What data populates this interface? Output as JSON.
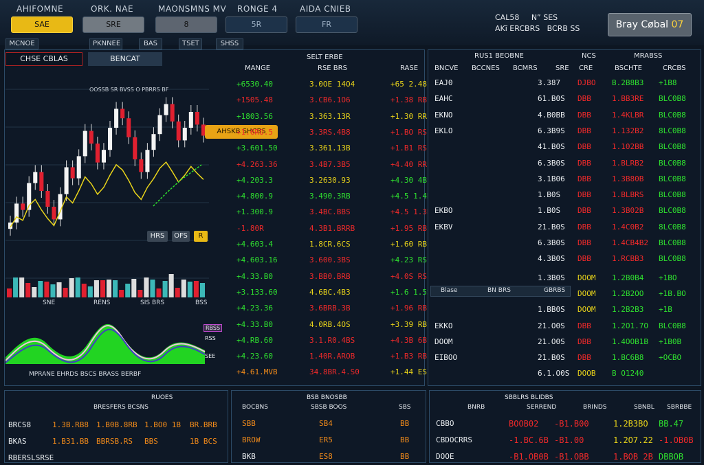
{
  "menu": {
    "items": [
      "AHIFOMNE",
      "ORK. NAE",
      "MAONSMNS MV",
      "RONGE 4",
      "AIDA CNIEB"
    ]
  },
  "toolbar": {
    "buttons": [
      "SAE",
      "SRE",
      "8",
      "5R",
      "FR"
    ]
  },
  "clock": {
    "line1": "CAL58     N” SES",
    "line2": "AKĩ ERCBRS   BCRB SS"
  },
  "buy_button": {
    "label": "Bray Cøbal",
    "suffix": "07"
  },
  "tabs": [
    "MCNOE",
    "PKNNEE",
    "BAS",
    "TSET",
    "SHSS"
  ],
  "left_tabs": {
    "active": "CHSE CBLAS",
    "second": "BENCAT"
  },
  "chart": {
    "title": "OOSSB SR BVSS O PBRRS BF",
    "badge": "AHSKB SHCBS",
    "mini_labels": [
      "HRS",
      "OFS",
      "R"
    ],
    "axis_labels": [
      "SNE",
      "RENS",
      "SIS BRS",
      "BSS"
    ],
    "osc_labels": [
      "RBSS",
      "RSS",
      "SEE"
    ],
    "osc_axis": "MPRANE EHRDS BSCS BRASS BERBF"
  },
  "chart_data": {
    "type": "line",
    "title": "OOSSB SR BVSS O PBRRS BF",
    "xlabel": "",
    "ylabel": "",
    "series": [
      {
        "values": [
          20,
          32,
          28,
          45,
          52,
          40,
          30,
          22,
          38,
          55,
          48,
          62,
          78,
          70,
          58,
          66,
          80,
          92,
          86,
          74,
          60,
          52,
          66,
          76,
          88,
          95,
          84,
          72,
          80,
          90,
          82,
          75
        ]
      }
    ]
  },
  "quotes_headers": [
    "MANGE",
    "RSE BRS",
    "RASE"
  ],
  "quotes_title": "SELT ERBE",
  "quotes": [
    [
      "+6530.40",
      "3.0OE 14O4",
      "+65 2.48"
    ],
    [
      "+1505.48",
      "3.CB6.1O6",
      "+1.38 RB"
    ],
    [
      "+1803.56",
      "3.363.13R",
      "+1.30 RR"
    ],
    [
      "+1.6RO.5",
      "3.3RS.4B8",
      "+1.BO RS"
    ],
    [
      "+3.601.50",
      "3.361.13B",
      "+1.B1 RS"
    ],
    [
      "+4.263.36",
      "3.4B7.3B5",
      "+4.40 RR"
    ],
    [
      "+4.203.3",
      "3.2630.93",
      "+4.30 4B"
    ],
    [
      "+4.800.9",
      "3.490.3RB",
      "+4.5 1.4B"
    ],
    [
      "+1.300.9",
      "3.4BC.BBS",
      "+4.5 1.3B"
    ],
    [
      "-1.80R",
      "4.3B1.BRRB",
      "+1.95 RB"
    ],
    [
      "+4.603.4",
      "1.8CR.6CS",
      "+1.60 RB"
    ],
    [
      "+4.603.16",
      "3.600.3BS",
      "+4.23 RS"
    ],
    [
      "+4.33.B0",
      "3.BB0.BRB",
      "+4.0S RS"
    ],
    [
      "+3.133.60",
      "4.6BC.4B3",
      "+1.6 1.5S"
    ],
    [
      "+4.23.36",
      "3.6BRB.3B",
      "+1.96 RB"
    ],
    [
      "+4.33.B0",
      "4.0RB.4OS",
      "+3.39 RB"
    ],
    [
      "+4.RB.60",
      "3.1.R0.4BS",
      "+4.3B 6B"
    ],
    [
      "+4.23.60",
      "1.40R.AROB",
      "+1.B3 RB"
    ],
    [
      "+4.61.MVB",
      "34.8BR.4.S0",
      "+1.44 ES"
    ]
  ],
  "right_panel": {
    "title": "RUS1 BEOBNE",
    "subtitle_left": "NCS",
    "subtitle_right": "MRABSS",
    "headers": [
      "BNCVE",
      "BCCNES",
      "BCMRS",
      "SRE",
      "CRE",
      "BSCHTE",
      "CRCBS"
    ],
    "rows": [
      [
        "EAJ0",
        "3.387",
        "DJBO",
        "B.2B8B3",
        "+1B8"
      ],
      [
        "EAHC",
        "61.B0S",
        "DBB",
        "1.BB3RE",
        "BLC0B8"
      ],
      [
        "EKNO",
        "4.B0BB",
        "DBB",
        "1.4KLBR",
        "BLC0B8"
      ],
      [
        "EKLO",
        "6.3B9S",
        "DBB",
        "1.132B2",
        "8LC0B8"
      ],
      [
        "",
        "41.B0S",
        "DBB",
        "1.102BB",
        "BLC0B8"
      ],
      [
        "",
        "6.3B0S",
        "DBB",
        "1.BLRB2",
        "BLC0B8"
      ],
      [
        "",
        "3.1B06",
        "DBB",
        "1.3B80B",
        "BLC0B8"
      ],
      [
        "",
        "1.B0S",
        "DBB",
        "1.BLBRS",
        "BLC0B8"
      ],
      [
        "EKBO",
        "1.B0S",
        "DBB",
        "1.3B02B",
        "BLC0B8"
      ],
      [
        "EKBV",
        "21.B0S",
        "DBB",
        "1.4C0B2",
        "8LC0B8"
      ],
      [
        "",
        "6.3B0S",
        "DBB",
        "1.4CB4B2",
        "BLC0B8"
      ],
      [
        "",
        "4.3B0S",
        "DBB",
        "1.RCBB3",
        "BLC0B8"
      ],
      [
        "",
        "1.3B0S",
        "DOOM",
        "1.2B0B4",
        "+1BO"
      ],
      [
        "",
        "1.BB0S",
        "DOOM",
        "1.2B2OO",
        "+1B.BO"
      ],
      [
        "",
        "1.BB0S",
        "DOOM",
        "1.2B2B3",
        "+1B"
      ],
      [
        "EKKO",
        "21.O0S",
        "DBB",
        "1.2O1.7O",
        "BLC0B8"
      ],
      [
        "DOOM",
        "21.O0S",
        "DBB",
        "1.4OOB1B",
        "+1B0B"
      ],
      [
        "EIBOO",
        "21.B0S",
        "DBB",
        "1.BC6B8",
        "+OCBO"
      ],
      [
        "",
        "6.1.O0S",
        "DOOB",
        "B O1240",
        ""
      ]
    ],
    "tab_bar": [
      "Blase",
      "BN BRS",
      "GBRBS"
    ]
  },
  "bottom": {
    "panel1": {
      "title": "RUOES",
      "subtitle": "BRESFERS BCSNS",
      "rows": [
        [
          "BRCS8",
          "1.3B.RB8",
          "1.B0B.8RB",
          "1.BO0 1B",
          "BR.BRB"
        ],
        [
          "BKAS",
          "1.B31.BB",
          "BBRSB.RS",
          "BBS",
          "1B BCS"
        ],
        [
          "RBERSLSRSE",
          "",
          "",
          "",
          ""
        ]
      ]
    },
    "panel2": {
      "title": "BSB BNOSBB",
      "headers": [
        "BOCBNS",
        "SBSB BOOS",
        "SBS"
      ],
      "rows": [
        [
          "SBB",
          "SB4",
          "BB"
        ],
        [
          "BROW",
          "ER5",
          "BB"
        ],
        [
          "BKB",
          "ES8",
          "BB"
        ]
      ]
    },
    "panel3": {
      "title": "SBBLRS BLIDBS",
      "headers": [
        "BNRB",
        "SERREND",
        "BRINDS",
        "SBNBL",
        "SBRBBE"
      ],
      "rows": [
        [
          "CBBO",
          "BOOB02",
          "-B1.B00",
          "1.2B3BO",
          "BB.47"
        ],
        [
          "CBDOCRRS",
          "-1.BC.6B",
          "-B1.00",
          "1.2O7.22",
          "-1.OB0B"
        ],
        [
          "DOOE",
          "-B1.OB0B",
          "-B1.OBB",
          "1.BOB 2B",
          "DBBOB"
        ]
      ]
    }
  }
}
